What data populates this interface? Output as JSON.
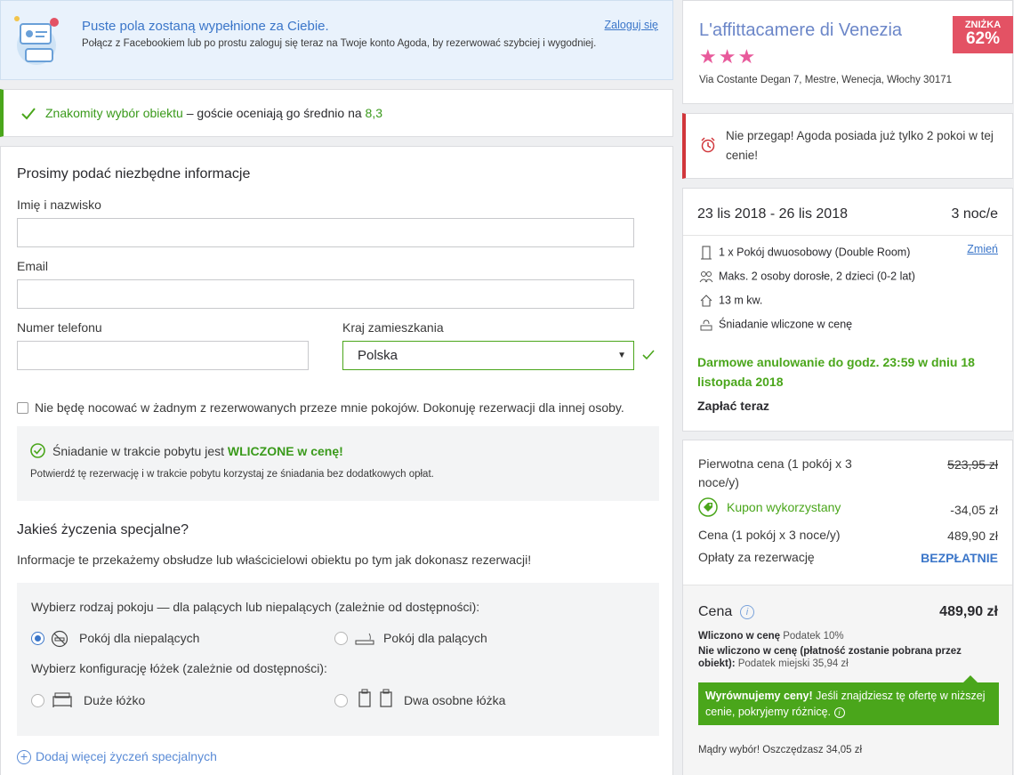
{
  "login_banner": {
    "title": "Puste pola zostaną wypełnione za Ciebie.",
    "description": "Połącz z Facebookiem lub po prostu zaloguj się teraz na Twoje konto Agoda, by rezerwować szybciej i wygodniej.",
    "login_link": "Zaloguj się"
  },
  "good_choice": {
    "highlight": "Znakomity wybór obiektu",
    "text": " – goście oceniają go średnio na ",
    "score": "8,3"
  },
  "form": {
    "heading": "Prosimy podać niezbędne informacje",
    "name_label": "Imię i nazwisko",
    "email_label": "Email",
    "phone_label": "Numer telefonu",
    "country_label": "Kraj zamieszkania",
    "country_value": "Polska",
    "not_staying_label": "Nie będę nocować w żadnym z rezerwowanych przeze mnie pokojów. Dokonuję rezerwacji dla innej osoby.",
    "breakfast": {
      "title_prefix": "Śniadanie w trakcie pobytu jest ",
      "title_highlight": "WLICZONE w cenę!",
      "subtitle": "Potwierdź tę rezerwację i w trakcie pobytu korzystaj ze śniadania bez dodatkowych opłat."
    },
    "special_heading": "Jakieś życzenia specjalne?",
    "special_info": "Informacje te przekażemy obsłudze lub właścicielowi obiektu po tym jak dokonasz rezerwacji!",
    "smoking_label": "Wybierz rodzaj pokoju — dla palących lub niepalących (zależnie od dostępności):",
    "non_smoking": "Pokój dla niepalących",
    "smoking": "Pokój dla palących",
    "bed_label": "Wybierz konfigurację łóżek (zależnie od dostępności):",
    "large_bed": "Duże łóżko",
    "twin_beds": "Dwa osobne łóżka",
    "add_more": "Dodaj więcej życzeń specjalnych"
  },
  "hotel": {
    "name": "L'affittacamere di Venezia",
    "stars": "★★★",
    "address": "Via Costante Degan 7, Mestre, Wenecja, Włochy 30171",
    "discount_label": "ZNIŻKA",
    "discount_value": "62%"
  },
  "alert": {
    "text": "Nie przegap! Agoda posiada już tylko 2 pokoi w tej cenie!"
  },
  "booking": {
    "dates": "23 lis 2018 - 26 lis 2018",
    "nights": "3 noc/e",
    "room": "1 x Pokój dwuosobowy (Double Room)",
    "change": "Zmień",
    "occupancy": "Maks. 2 osoby dorosłe, 2 dzieci (0-2 lat)",
    "size": "13 m kw.",
    "breakfast": "Śniadanie wliczone w cenę",
    "cancellation": "Darmowe anulowanie do godz. 23:59 w dniu 18 listopada 2018",
    "pay": "Zapłać teraz"
  },
  "price": {
    "original_label": "Pierwotna cena (1 pokój x 3 noce/y)",
    "original_value": "523,95 zł",
    "coupon_label": "Kupon wykorzystany",
    "coupon_value": "-34,05 zł",
    "price_label": "Cena (1 pokój x 3 noce/y)",
    "price_value": "489,90 zł",
    "fees_label": "Opłaty za rezerwację",
    "fees_value": "BEZPŁATNIE",
    "total_label": "Cena",
    "total_value": "489,90 zł",
    "included_bold": "Wliczono w cenę",
    "included_rest": " Podatek 10%",
    "not_included_bold": "Nie wliczono w cenę (płatność zostanie pobrana przez obiekt):",
    "not_included_rest": " Podatek miejski 35,94 zł",
    "match_bold": "Wyrównujemy ceny!",
    "match_rest": " Jeśli znajdziesz tę ofertę w niższej cenie, pokryjemy różnicę.",
    "savings": "Mądry wybór! Oszczędzasz 34,05 zł"
  },
  "colors": {
    "accent_blue": "#3b76c9",
    "green": "#4aa61b",
    "alert_red": "#d1363b",
    "star_pink": "#e85a9b",
    "badge_red": "#e35264"
  }
}
